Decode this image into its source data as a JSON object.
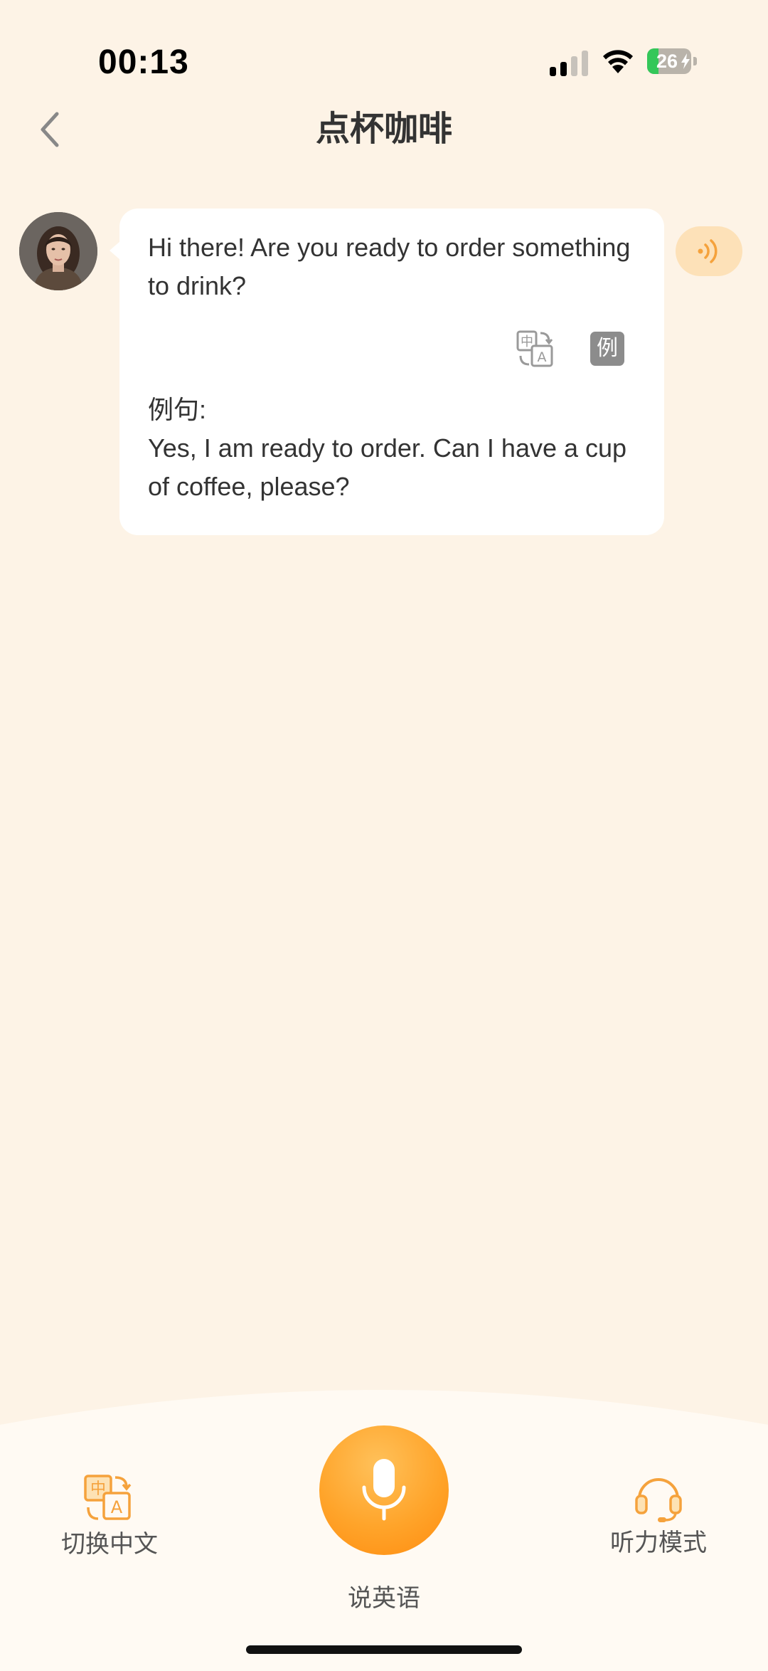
{
  "status_bar": {
    "time": "00:13",
    "battery_level": "26",
    "battery_fraction": 0.26,
    "signal_icon": "cellular-signal-icon",
    "wifi_icon": "wifi-icon"
  },
  "nav": {
    "back_icon": "chevron-left-icon",
    "title": "点杯咖啡"
  },
  "chat": {
    "message": "Hi there! Are you ready to order something to drink?",
    "translate_icon": "translate-icon",
    "example_badge": "例",
    "example_label": "例句:",
    "example_sentence": "Yes, I am ready to order. Can I have a cup of coffee, please?",
    "play_icon": "sound-wave-icon"
  },
  "bottom_bar": {
    "switch_chinese_label": "切换中文",
    "speak_english_label": "说英语",
    "listening_mode_label": "听力模式"
  },
  "colors": {
    "background": "#fdf3e6",
    "accent": "#ffa42a",
    "icon_orange": "#f5a23c",
    "text": "#333333",
    "battery_green": "#34c759"
  }
}
